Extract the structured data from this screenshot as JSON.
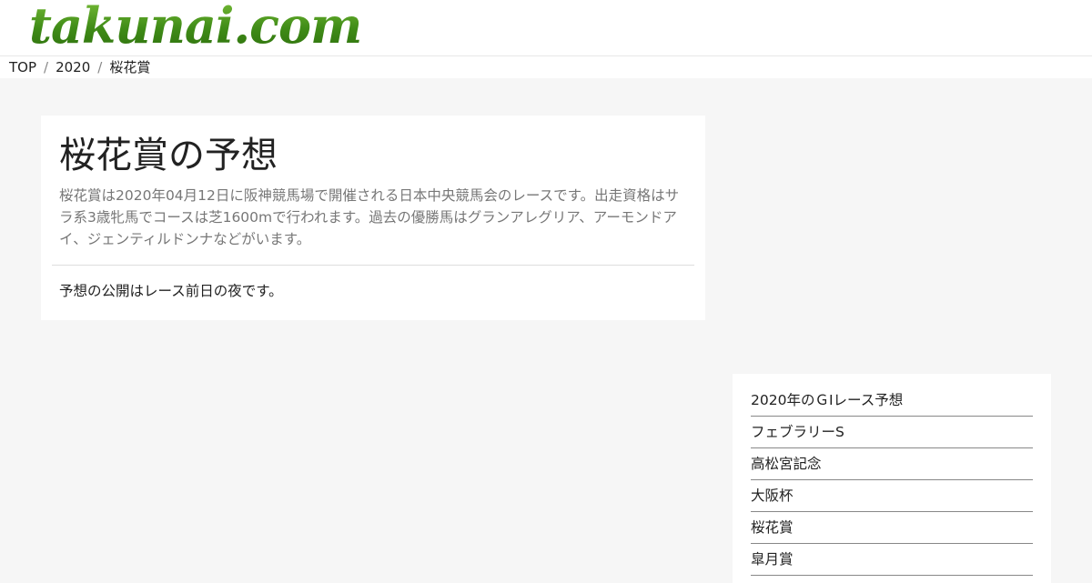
{
  "site": {
    "logo_text": "takunai.com",
    "brand_color": "#4f9a1e"
  },
  "breadcrumb": {
    "items": [
      "TOP",
      "2020",
      "桜花賞"
    ],
    "separator": "/"
  },
  "article": {
    "title": "桜花賞の予想",
    "description": "桜花賞は2020年04月12日に阪神競馬場で開催される日本中央競馬会のレースです。出走資格はサラ系3歳牝馬でコースは芝1600mで行われます。過去の優勝馬はグランアレグリア、アーモンドアイ、ジェンティルドンナなどがいます。",
    "note": "予想の公開はレース前日の夜です。"
  },
  "sidebar": {
    "items": [
      "2020年のＧⅠレース予想",
      "フェブラリーS",
      "高松宮記念",
      "大阪杯",
      "桜花賞",
      "皐月賞"
    ]
  }
}
